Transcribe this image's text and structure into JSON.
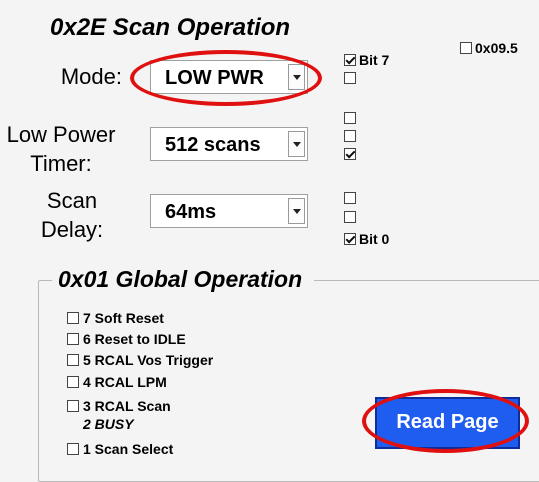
{
  "scan_operation": {
    "title": "0x2E Scan Operation",
    "mode": {
      "label": "Mode:",
      "value": "LOW PWR"
    },
    "low_power_timer": {
      "label_line1": "Low Power",
      "label_line2": "Timer:",
      "value": "512 scans"
    },
    "scan_delay": {
      "label_line1": "Scan",
      "label_line2": "Delay:",
      "value": "64ms"
    }
  },
  "register_bits": [
    {
      "label": "Bit 7",
      "checked": true
    },
    {
      "label": "",
      "checked": false
    },
    {
      "label": "",
      "checked": false
    },
    {
      "label": "",
      "checked": false
    },
    {
      "label": "",
      "checked": true
    },
    {
      "label": "",
      "checked": false
    },
    {
      "label": "",
      "checked": false
    },
    {
      "label": "Bit 0",
      "checked": true
    }
  ],
  "extra_checkbox": {
    "label": "0x09.5",
    "checked": false
  },
  "global_operation": {
    "title": "0x01 Global Operation",
    "items": [
      {
        "label": "7 Soft Reset",
        "checked": false
      },
      {
        "label": "6 Reset to IDLE",
        "checked": false
      },
      {
        "label": "5 RCAL Vos Trigger",
        "checked": false
      },
      {
        "label": "4 RCAL LPM",
        "checked": false
      },
      {
        "label": "3 RCAL Scan",
        "checked": false
      },
      {
        "label": "1 Scan Select",
        "checked": false
      }
    ],
    "busy_note": "2 BUSY"
  },
  "read_page_button": {
    "label": "Read Page"
  },
  "colors": {
    "background": "#f4f4f4",
    "button": "#1f5df0",
    "annotation_red": "#e01010"
  }
}
